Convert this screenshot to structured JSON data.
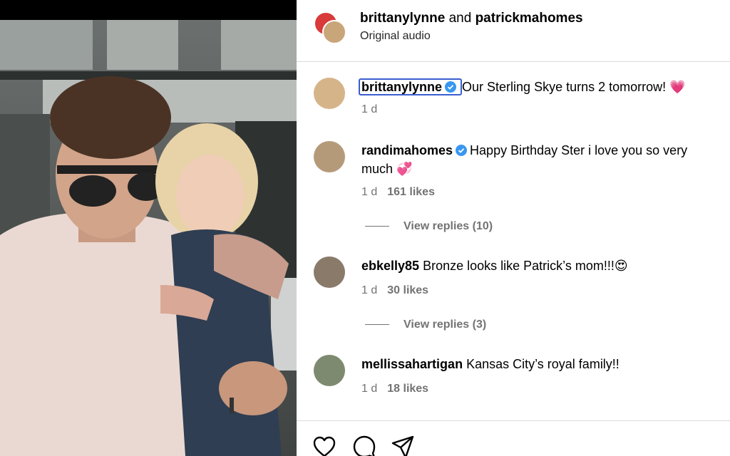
{
  "header": {
    "user1": "brittanylynne",
    "connector": "and",
    "user2": "patrickmahomes",
    "audio": "Original audio"
  },
  "caption": {
    "username": "brittanylynne",
    "text": "Our Sterling Skye turns 2 tomorrow! 💗",
    "time": "1 d"
  },
  "comments": [
    {
      "username": "randimahomes",
      "text": "Happy Birthday Ster i love you so very much 💞",
      "time": "1 d",
      "likes": "161 likes",
      "replies": "View replies (10)"
    },
    {
      "username": "ebkelly85",
      "text": "Bronze looks like Patrick’s mom!!!😍",
      "time": "1 d",
      "likes": "30 likes",
      "replies": "View replies (3)"
    },
    {
      "username": "mellissahartigan",
      "text": "Kansas City’s royal family!!",
      "time": "1 d",
      "likes": "18 likes"
    }
  ],
  "actions": [
    "heart-icon",
    "comment-icon",
    "share-icon"
  ],
  "colors": {
    "verified": "#3897f0",
    "meta": "#737373",
    "focus": "#3b5dd0"
  }
}
